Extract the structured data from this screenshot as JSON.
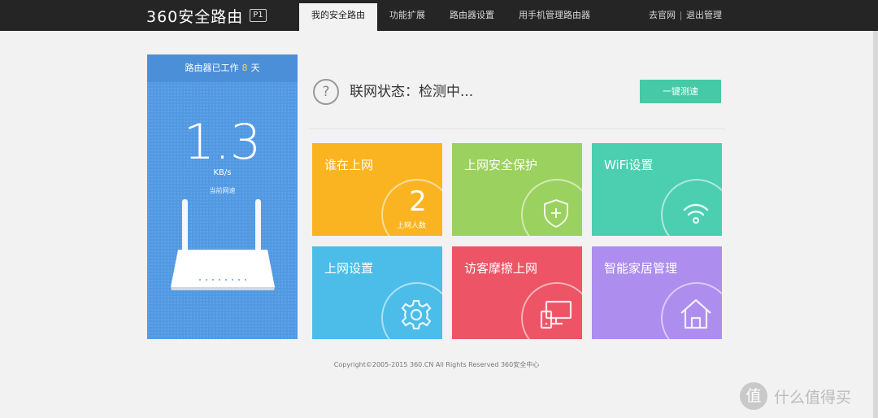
{
  "brand": {
    "name": "360安全路由",
    "badge": "P1"
  },
  "nav": {
    "tabs": [
      {
        "label": "我的安全路由",
        "active": true
      },
      {
        "label": "功能扩展",
        "active": false
      },
      {
        "label": "路由器设置",
        "active": false
      },
      {
        "label": "用手机管理路由器",
        "active": false
      }
    ],
    "links": {
      "site": "去官网",
      "logout": "退出管理"
    }
  },
  "speed_panel": {
    "uptime_prefix": "路由器已工作",
    "uptime_days": "8",
    "uptime_suffix": "天",
    "speed_value": "1.3",
    "speed_unit": "KB/s",
    "speed_caption": "当前网速"
  },
  "status": {
    "icon": "question-icon",
    "text": "联网状态：检测中...",
    "speedtest_label": "一键测速"
  },
  "tiles": [
    {
      "title": "谁在上网",
      "color": "#fbb421",
      "count": "2",
      "count_label": "上网人数"
    },
    {
      "title": "上网安全保护",
      "color": "#9bd15f",
      "icon": "shield-plus-icon"
    },
    {
      "title": "WiFi设置",
      "color": "#4ccfb1",
      "icon": "wifi-icon"
    },
    {
      "title": "上网设置",
      "color": "#4bbde8",
      "icon": "gear-icon"
    },
    {
      "title": "访客摩擦上网",
      "color": "#ed5466",
      "icon": "guest-devices-icon"
    },
    {
      "title": "智能家居管理",
      "color": "#ad8ded",
      "icon": "home-icon"
    }
  ],
  "footer": "Copyright©2005-2015 360.CN All Rights Reserved 360安全中心",
  "watermark": {
    "badge": "值",
    "text": "什么值得买"
  },
  "colors": {
    "topbar": "#252525",
    "panel": "#5199e3",
    "accent": "#45c9a6"
  }
}
